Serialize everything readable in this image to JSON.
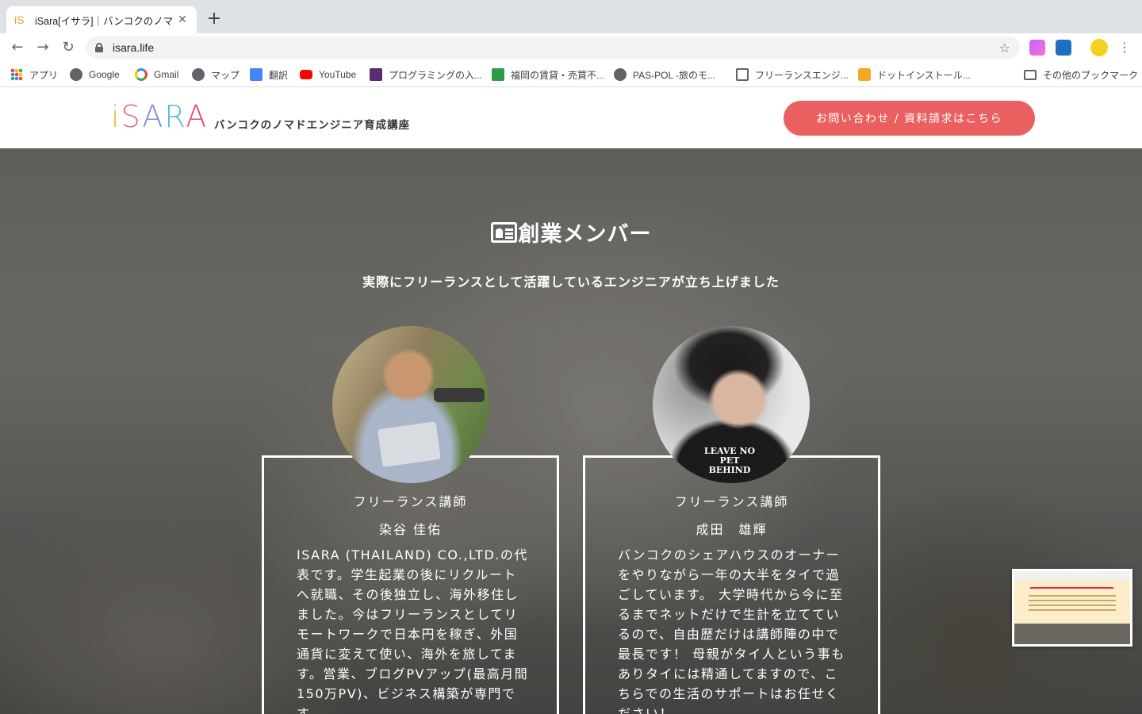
{
  "browser": {
    "tab": {
      "title": "iSara[イサラ]｜バンコクのノマドエ",
      "favicon": "iS",
      "close_icon": "close-icon"
    },
    "new_tab_label": "+",
    "url": "isara.life",
    "bookmarks": [
      {
        "label": "アプリ",
        "icon": "apps-grid-icon"
      },
      {
        "label": "Google",
        "icon": "globe-icon"
      },
      {
        "label": "Gmail",
        "icon": "google-g-icon"
      },
      {
        "label": "マップ",
        "icon": "globe-icon"
      },
      {
        "label": "翻訳",
        "icon": "translate-icon"
      },
      {
        "label": "YouTube",
        "icon": "youtube-icon"
      },
      {
        "label": "プログラミングの入...",
        "icon": "purple-p-icon"
      },
      {
        "label": "福岡の賃貸・売買不...",
        "icon": "house-icon"
      },
      {
        "label": "PAS-POL -旅のモ...",
        "icon": "globe-icon"
      },
      {
        "label": "フリーランスエンジ...",
        "icon": "house-icon"
      },
      {
        "label": "ドットインストール...",
        "icon": "dotinstall-icon"
      },
      {
        "label": "その他のブックマーク",
        "icon": "folder-icon"
      }
    ]
  },
  "site": {
    "logo": [
      "i",
      "S",
      "A",
      "R",
      "A"
    ],
    "tagline": "バンコクのノマドエンジニア育成講座",
    "cta_label": "お問い合わせ / 資料請求はこちら"
  },
  "section": {
    "title": "創業メンバー",
    "subtitle": "実際にフリーランスとして活躍しているエンジニアが立ち上げました"
  },
  "members": [
    {
      "role": "フリーランス講師",
      "name": "染谷 佳佑",
      "bio": "ISARA (THAILAND) CO.,LTD.の代表です。学生起業の後にリクルートへ就職、その後独立し、海外移住しました。今はフリーランスとしてリモートワークで日本円を稼ぎ、外国通貨に変えて使い、海外を旅してます。営業、ブログPVアップ(最高月間150万PV)、ビジネス構築が専門です。"
    },
    {
      "role": "フリーランス講師",
      "name": "成田　雄輝",
      "bio": "バンコクのシェアハウスのオーナーをやりながら一年の大半をタイで過ごしています。 大学時代から今に至るまでネットだけで生計を立てているので、自由歴だけは講師陣の中で最長です！ 母親がタイ人という事もありタイには精通してますので、こちらでの生活のサポートはお任せください！",
      "shirt_text": "LEAVE NO PET BEHIND"
    }
  ],
  "colors": {
    "cta": "#ea5f5f",
    "header_bg": "#ffffff"
  }
}
